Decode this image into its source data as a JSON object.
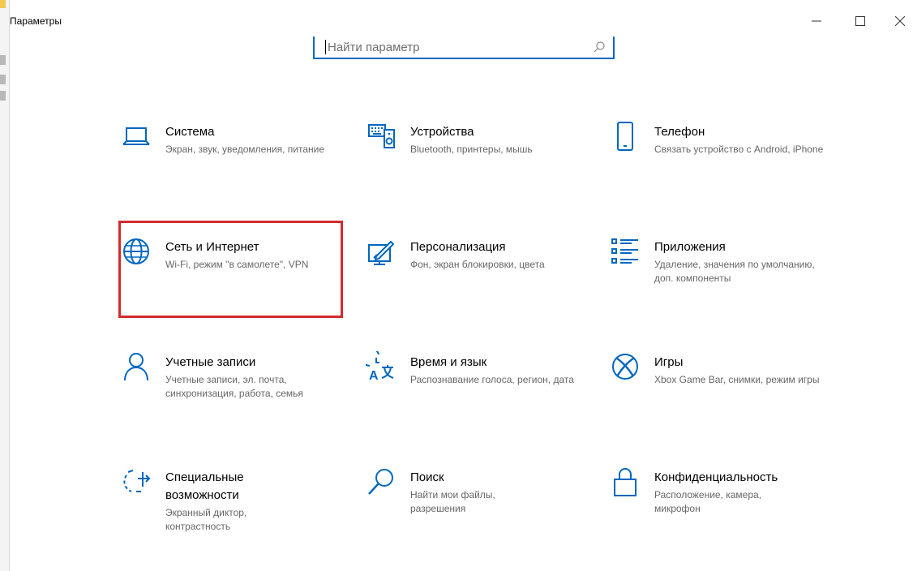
{
  "window": {
    "title": "Параметры"
  },
  "search": {
    "placeholder": "Найти параметр"
  },
  "tiles": [
    {
      "title": "Система",
      "desc": "Экран, звук, уведомления, питание",
      "icon": "laptop-icon"
    },
    {
      "title": "Устройства",
      "desc": "Bluetooth, принтеры, мышь",
      "icon": "keyboard-speaker-icon"
    },
    {
      "title": "Телефон",
      "desc": "Связать устройство с Android, iPhone",
      "icon": "phone-icon"
    },
    {
      "title": "Сеть и Интернет",
      "desc": "Wi-Fi, режим \"в самолете\", VPN",
      "icon": "globe-icon"
    },
    {
      "title": "Персонализация",
      "desc": "Фон, экран блокировки, цвета",
      "icon": "paint-pen-icon"
    },
    {
      "title": "Приложения",
      "desc": "Удаление, значения по умолчанию, доп. компоненты",
      "icon": "apps-list-icon"
    },
    {
      "title": "Учетные записи",
      "desc": "Учетные записи, эл. почта, синхронизация, работа, семья",
      "icon": "person-icon"
    },
    {
      "title": "Время и язык",
      "desc": "Распознавание голоса, регион, дата",
      "icon": "time-language-icon"
    },
    {
      "title": "Игры",
      "desc": "Xbox Game Bar, снимки, режим игры",
      "icon": "xbox-icon"
    },
    {
      "title": "Специальные возможности",
      "desc": "Экранный диктор, контрастность",
      "icon": "accessibility-icon"
    },
    {
      "title": "Поиск",
      "desc": "Найти мои файлы, разрешения",
      "icon": "search-icon"
    },
    {
      "title": "Конфиденциальность",
      "desc": "Расположение, камера, микрофон",
      "icon": "lock-icon"
    }
  ],
  "highlight_color": "#d32b2b",
  "accent_color": "#0067c0"
}
